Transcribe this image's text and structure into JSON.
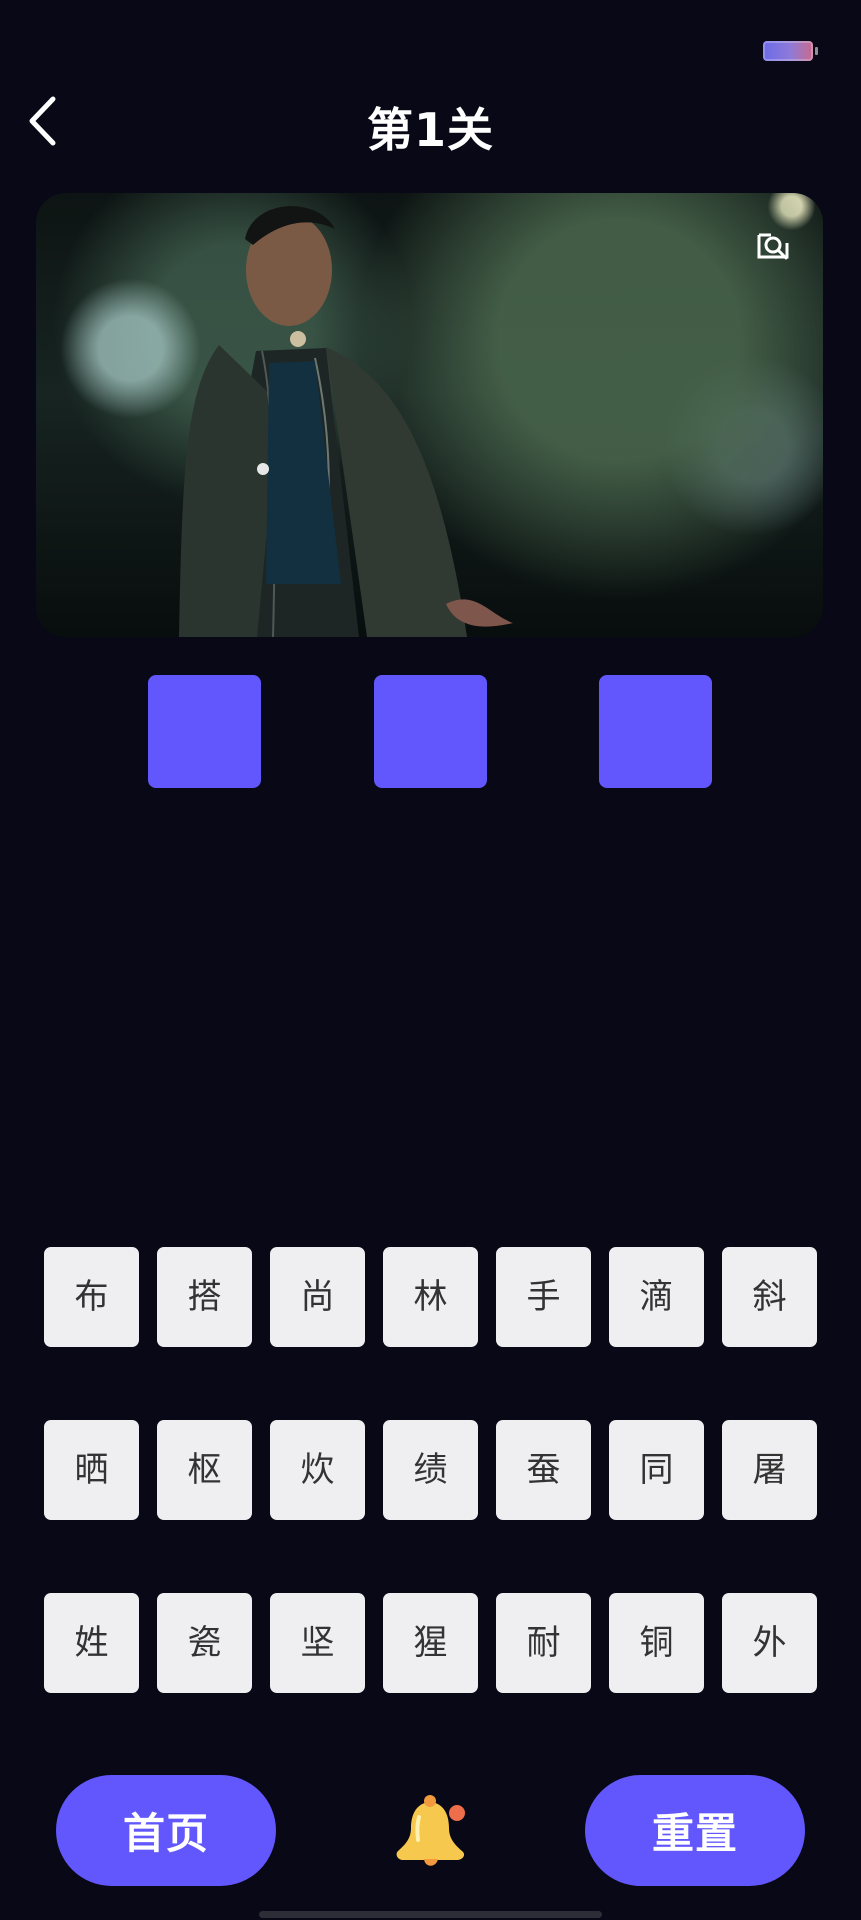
{
  "status_bar": {
    "battery_icon": "battery-icon"
  },
  "header": {
    "title": "第1关",
    "back_icon": "chevron-left-icon"
  },
  "puzzle": {
    "zoom_icon": "zoom-image-icon",
    "answer_slots": [
      "",
      "",
      ""
    ]
  },
  "character_tiles": [
    "布",
    "搭",
    "尚",
    "林",
    "手",
    "滴",
    "斜",
    "晒",
    "枢",
    "炊",
    "绩",
    "蚕",
    "同",
    "屠",
    "姓",
    "瓷",
    "坚",
    "猩",
    "耐",
    "铜",
    "外"
  ],
  "footer": {
    "home_label": "首页",
    "reset_label": "重置",
    "bell_icon": "bell-icon"
  },
  "colors": {
    "background": "#090816",
    "accent": "#6257fc",
    "tile_background": "#efeff1",
    "tile_text": "#333333"
  }
}
